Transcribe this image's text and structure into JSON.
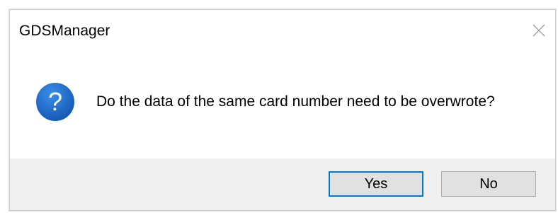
{
  "window": {
    "title": "GDSManager",
    "close_icon": "close-icon"
  },
  "message": {
    "icon": "question-icon",
    "icon_glyph": "?",
    "icon_color": "#1c65c2",
    "text": "Do the data of the same card number need to be overwrote?"
  },
  "buttons": {
    "yes_label": "Yes",
    "no_label": "No",
    "default": "Yes",
    "accent": "#0078d7"
  }
}
